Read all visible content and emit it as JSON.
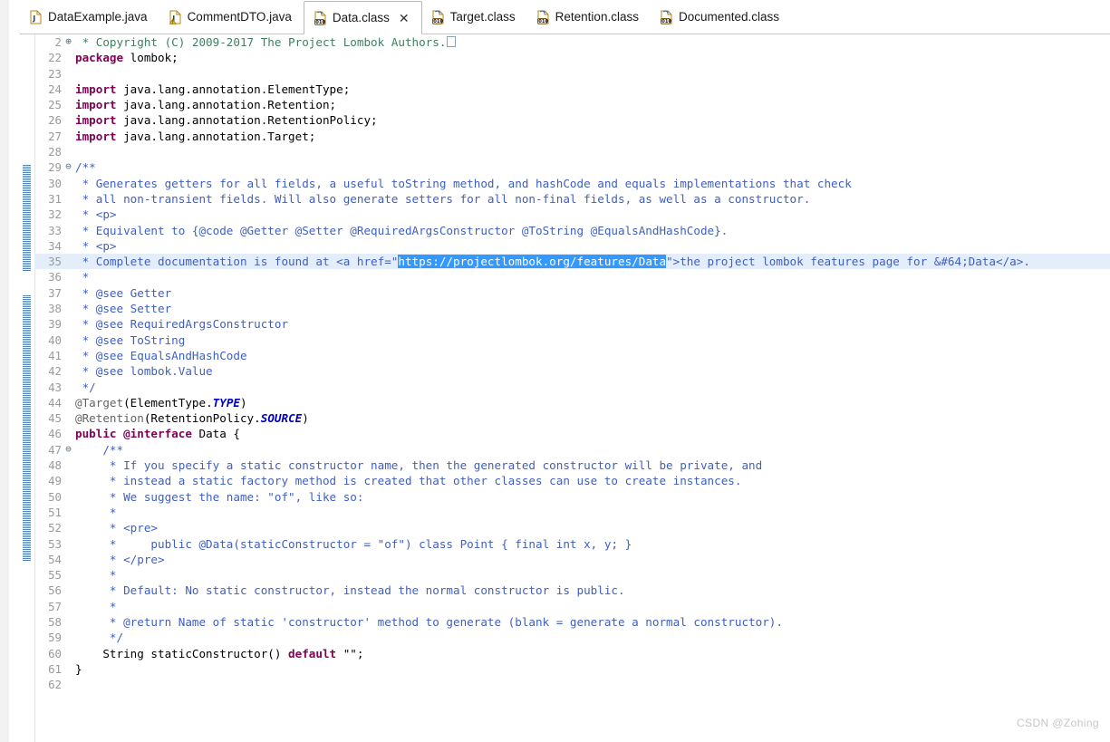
{
  "window": {
    "title": "Data.class",
    "watermark": "CSDN @Zohing"
  },
  "tabs": [
    {
      "label": "DataExample.java",
      "icon": "java-file-icon",
      "active": false,
      "closable": false,
      "warning": false
    },
    {
      "label": "CommentDTO.java",
      "icon": "java-file-warning-icon",
      "active": false,
      "closable": false,
      "warning": true
    },
    {
      "label": "Data.class",
      "icon": "class-file-icon",
      "active": true,
      "closable": true,
      "close_glyph": "✕",
      "warning": false
    },
    {
      "label": "Target.class",
      "icon": "class-file-icon",
      "active": false,
      "closable": false,
      "warning": false
    },
    {
      "label": "Retention.class",
      "icon": "class-file-icon",
      "active": false,
      "closable": false,
      "warning": false
    },
    {
      "label": "Documented.class",
      "icon": "class-file-icon",
      "active": false,
      "closable": false,
      "warning": false
    }
  ],
  "colors": {
    "javadoc_comment": "#3f5fbf",
    "keyword": "#7f0055",
    "annotation": "#646464",
    "static_field": "#0000c0",
    "string": "#2a00ff",
    "selection_bg": "#3399ff",
    "line_highlight": "#e8f0fb",
    "line_number": "#9a9a9a"
  },
  "editor": {
    "selection_text": "https://projectlombok.org/features/Data",
    "selected_line_number": 35,
    "fold_markers": {
      "2": "⊕",
      "29": "⊖",
      "47": "⊖"
    },
    "lines": [
      {
        "n": "2",
        "text": " * Copyright (C) 2009-2017 The Project Lombok Authors."
      },
      {
        "n": "22",
        "text": "package lombok;"
      },
      {
        "n": "23",
        "text": ""
      },
      {
        "n": "24",
        "text": "import java.lang.annotation.ElementType;"
      },
      {
        "n": "25",
        "text": "import java.lang.annotation.Retention;"
      },
      {
        "n": "26",
        "text": "import java.lang.annotation.RetentionPolicy;"
      },
      {
        "n": "27",
        "text": "import java.lang.annotation.Target;"
      },
      {
        "n": "28",
        "text": ""
      },
      {
        "n": "29",
        "text": "/**"
      },
      {
        "n": "30",
        "text": " * Generates getters for all fields, a useful toString method, and hashCode and equals implementations that check"
      },
      {
        "n": "31",
        "text": " * all non-transient fields. Will also generate setters for all non-final fields, as well as a constructor."
      },
      {
        "n": "32",
        "text": " * <p>"
      },
      {
        "n": "33",
        "text": " * Equivalent to {@code @Getter @Setter @RequiredArgsConstructor @ToString @EqualsAndHashCode}."
      },
      {
        "n": "34",
        "text": " * <p>"
      },
      {
        "n": "35",
        "text": " * Complete documentation is found at <a href=\"https://projectlombok.org/features/Data\">the project lombok features page for &#64;Data</a>."
      },
      {
        "n": "36",
        "text": " *"
      },
      {
        "n": "37",
        "text": " * @see Getter"
      },
      {
        "n": "38",
        "text": " * @see Setter"
      },
      {
        "n": "39",
        "text": " * @see RequiredArgsConstructor"
      },
      {
        "n": "40",
        "text": " * @see ToString"
      },
      {
        "n": "41",
        "text": " * @see EqualsAndHashCode"
      },
      {
        "n": "42",
        "text": " * @see lombok.Value"
      },
      {
        "n": "43",
        "text": " */"
      },
      {
        "n": "44",
        "text": "@Target(ElementType.TYPE)"
      },
      {
        "n": "45",
        "text": "@Retention(RetentionPolicy.SOURCE)"
      },
      {
        "n": "46",
        "text": "public @interface Data {"
      },
      {
        "n": "47",
        "text": "    /**"
      },
      {
        "n": "48",
        "text": "     * If you specify a static constructor name, then the generated constructor will be private, and"
      },
      {
        "n": "49",
        "text": "     * instead a static factory method is created that other classes can use to create instances."
      },
      {
        "n": "50",
        "text": "     * We suggest the name: \"of\", like so:"
      },
      {
        "n": "51",
        "text": "     *"
      },
      {
        "n": "52",
        "text": "     * <pre>"
      },
      {
        "n": "53",
        "text": "     *     public @Data(staticConstructor = \"of\") class Point { final int x, y; }"
      },
      {
        "n": "54",
        "text": "     * </pre>"
      },
      {
        "n": "55",
        "text": "     *"
      },
      {
        "n": "56",
        "text": "     * Default: No static constructor, instead the normal constructor is public."
      },
      {
        "n": "57",
        "text": "     *"
      },
      {
        "n": "58",
        "text": "     * @return Name of static 'constructor' method to generate (blank = generate a normal constructor)."
      },
      {
        "n": "59",
        "text": "     */"
      },
      {
        "n": "60",
        "text": "    String staticConstructor() default \"\";"
      },
      {
        "n": "61",
        "text": "}"
      },
      {
        "n": "62",
        "text": ""
      }
    ]
  }
}
